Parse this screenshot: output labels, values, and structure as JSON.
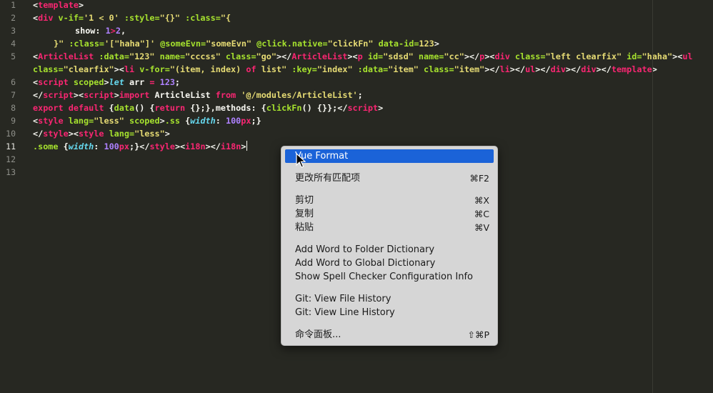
{
  "editor": {
    "line_numbers": [
      "1",
      "2",
      "3",
      "4",
      "5",
      "",
      "6",
      "7",
      "8",
      "9",
      "10",
      "11",
      "12",
      "13"
    ],
    "lines": {
      "l1_a": "<",
      "l1_b": "template",
      "l1_c": ">",
      "l2_a": "<",
      "l2_b": "div",
      "l2_c": " v-if=",
      "l2_d": "'1 < 0'",
      "l2_e": " :style=",
      "l2_f": "\"{}\"",
      "l2_g": " :class=",
      "l2_h": "\"{",
      "l3_a": "show: ",
      "l3_b": "1",
      "l3_c": ">",
      "l3_d": "2",
      "l3_e": ",",
      "l4_a": "}\"",
      "l4_b": " :class=",
      "l4_c": "'[\"haha\"]'",
      "l4_d": " @someEvn=",
      "l4_e": "\"someEvn\"",
      "l4_f": " @click.native=",
      "l4_g": "\"clickFn\"",
      "l4_h": " data-id=",
      "l4_i": "123",
      "l4_j": ">",
      "l5_a": "<",
      "l5_b": "ArticleList",
      "l5_c": " :data=",
      "l5_d": "\"123\"",
      "l5_e": " name=",
      "l5_f": "\"cccss\"",
      "l5_g": " class=",
      "l5_h": "\"go\"",
      "l5_i": "></",
      "l5_j": "ArticleList",
      "l5_k": "><",
      "l5_l": "p",
      "l5_m": " id=",
      "l5_n": "\"sdsd\"",
      "l5_o": " name=",
      "l5_p": "\"cc\"",
      "l5_q": "></",
      "l5_r": "p",
      "l5_s": "><",
      "l5_t": "div",
      "l5_u": " class=",
      "l5_v": "\"left clearfix\"",
      "l5_w": " id=",
      "l5_x": "\"haha\"",
      "l5_y": "><",
      "l5_z": "ul",
      "l5b_a": "class=",
      "l5b_b": "\"clearfix\"",
      "l5b_c": "><",
      "l5b_d": "li",
      "l5b_e": " v-for=",
      "l5b_f": "\"(item, index) ",
      "l5b_g": "of",
      "l5b_h": " list\"",
      "l5b_i": " :key=",
      "l5b_j": "\"index\"",
      "l5b_k": " :data=",
      "l5b_l": "\"item\"",
      "l5b_m": " class=",
      "l5b_n": "\"item\"",
      "l5b_o": "></",
      "l5b_p": "li",
      "l5b_q": "></",
      "l5b_r": "ul",
      "l5b_s": "></",
      "l5b_t": "div",
      "l5b_u": "></",
      "l5b_v": "div",
      "l5b_w": "></",
      "l5b_x": "template",
      "l5b_y": ">",
      "l6_a": "<",
      "l6_b": "script",
      "l6_c": " scoped",
      "l6_d": ">",
      "l6_e": "let",
      "l6_f": " arr ",
      "l6_g": "=",
      "l6_h": " ",
      "l6_i": "123",
      "l6_j": ";",
      "l7_a": "</",
      "l7_b": "script",
      "l7_c": "><",
      "l7_d": "script",
      "l7_e": ">",
      "l7_f": "import",
      "l7_g": " ArticleList ",
      "l7_h": "from",
      "l7_i": " ",
      "l7_j": "'@/modules/ArticleList'",
      "l7_k": ";",
      "l8_a": "export",
      "l8_b": " ",
      "l8_c": "default",
      "l8_d": " {",
      "l8_e": "data",
      "l8_f": "() {",
      "l8_g": "return",
      "l8_h": " {};},methods: {",
      "l8_i": "clickFn",
      "l8_j": "() {}};",
      "l8_k": "</",
      "l8_l": "script",
      "l8_m": ">",
      "l9_a": "<",
      "l9_b": "style",
      "l9_c": " lang=",
      "l9_d": "\"less\"",
      "l9_e": " scoped",
      "l9_f": ">",
      "l9_g": ".ss",
      "l9_h": " {",
      "l9_i": "width",
      "l9_j": ": ",
      "l9_k": "100",
      "l9_l": "px",
      "l9_m": ";}",
      "l10_a": "</",
      "l10_b": "style",
      "l10_c": "><",
      "l10_d": "style",
      "l10_e": " lang=",
      "l10_f": "\"less\"",
      "l10_g": ">",
      "l11_a": ".some",
      "l11_b": " {",
      "l11_c": "width",
      "l11_d": ": ",
      "l11_e": "100",
      "l11_f": "px",
      "l11_g": ";}",
      "l11_h": "</",
      "l11_i": "style",
      "l11_j": "><",
      "l11_k": "i18n",
      "l11_l": "></",
      "l11_m": "i18n",
      "l11_n": ">"
    }
  },
  "context_menu": {
    "items": [
      {
        "label": "Vue Format",
        "shortcut": ""
      },
      {
        "label": "更改所有匹配项",
        "shortcut": "⌘F2"
      },
      {
        "label": "剪切",
        "shortcut": "⌘X"
      },
      {
        "label": "复制",
        "shortcut": "⌘C"
      },
      {
        "label": "粘贴",
        "shortcut": "⌘V"
      },
      {
        "label": "Add Word to Folder Dictionary",
        "shortcut": ""
      },
      {
        "label": "Add Word to Global Dictionary",
        "shortcut": ""
      },
      {
        "label": "Show Spell Checker Configuration Info",
        "shortcut": ""
      },
      {
        "label": "Git: View File History",
        "shortcut": ""
      },
      {
        "label": "Git: View Line History",
        "shortcut": ""
      },
      {
        "label": "命令面板...",
        "shortcut": "⇧⌘P"
      }
    ]
  },
  "colors": {
    "background": "#272822",
    "tag": "#f92672",
    "attribute": "#a6e22e",
    "string": "#e6db74",
    "number": "#ae81ff",
    "type": "#66d9ef",
    "menu_highlight": "#1b63d8"
  }
}
